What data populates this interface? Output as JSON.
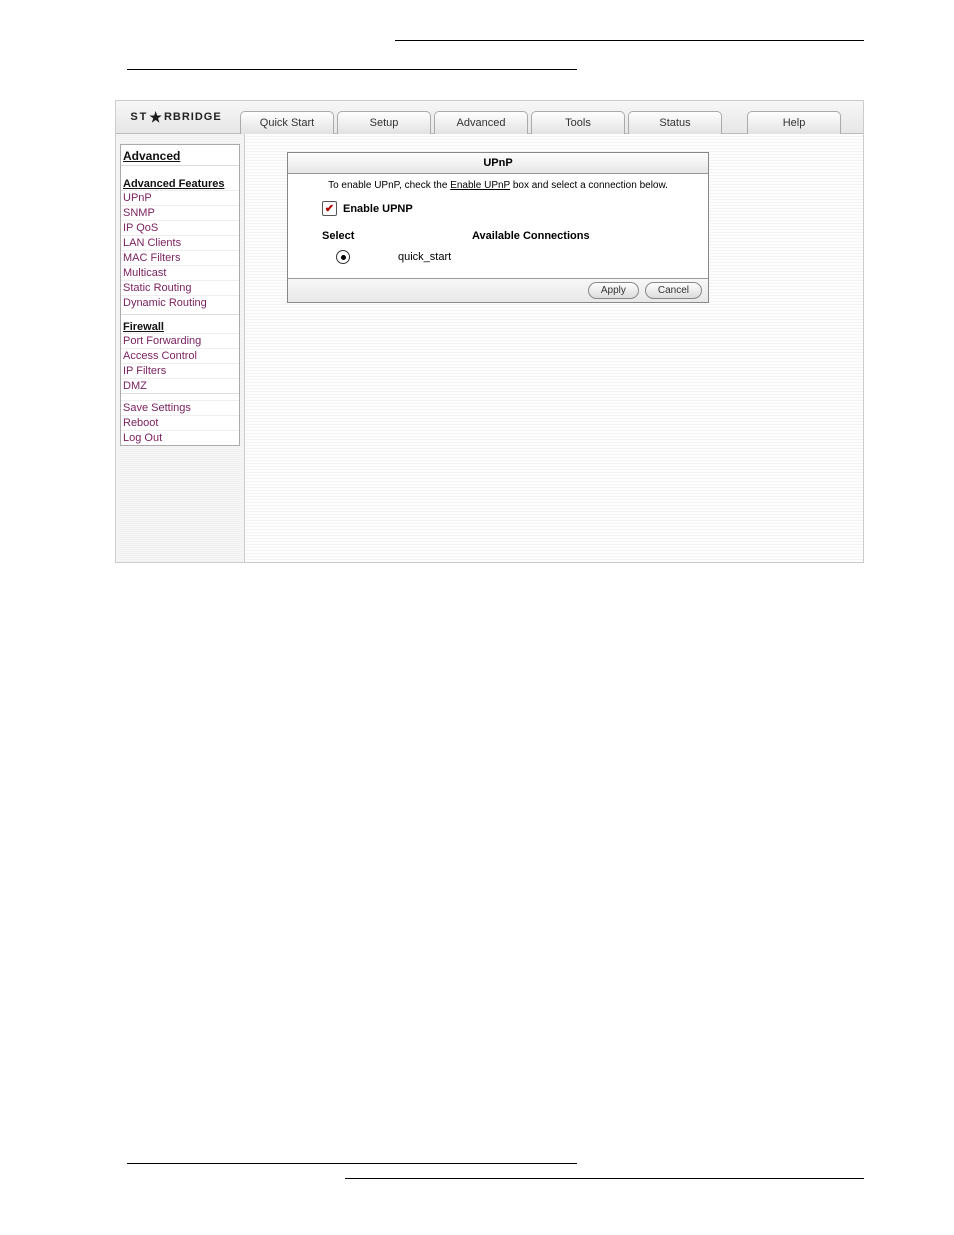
{
  "logo": {
    "prefix": "ST",
    "suffix": "RBRIDGE"
  },
  "tabs": [
    "Quick Start",
    "Setup",
    "Advanced",
    "Tools",
    "Status",
    "Help"
  ],
  "sidebar": {
    "title": "Advanced",
    "section1": {
      "header": "Advanced Features",
      "links": [
        "UPnP",
        "SNMP",
        "IP QoS",
        "LAN Clients",
        "MAC Filters",
        "Multicast",
        "Static Routing",
        "Dynamic Routing"
      ]
    },
    "section2": {
      "header": "Firewall",
      "links": [
        "Port Forwarding",
        "Access Control",
        "IP Filters",
        "DMZ"
      ]
    },
    "section3": {
      "links": [
        "Save Settings",
        "Reboot",
        "Log Out"
      ]
    }
  },
  "panel": {
    "title": "UPnP",
    "instruction_pre": "To enable UPnP, check the ",
    "instruction_link": "Enable UPnP",
    "instruction_post": " box and select a connection below.",
    "enable_label": "Enable UPNP",
    "select_header": "Select",
    "avail_header": "Available Connections",
    "connections": [
      {
        "name": "quick_start",
        "selected": true
      }
    ],
    "apply_label": "Apply",
    "cancel_label": "Cancel"
  }
}
